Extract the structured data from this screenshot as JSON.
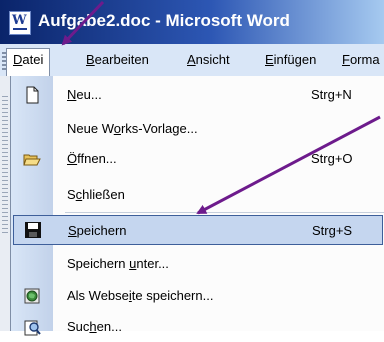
{
  "window": {
    "title": "Aufgabe2.doc - Microsoft Word",
    "app_icon": "word-doc-icon"
  },
  "menubar": {
    "items": [
      {
        "label_pre": "",
        "label_acc": "D",
        "label_post": "atei",
        "open": true
      },
      {
        "label_pre": "",
        "label_acc": "B",
        "label_post": "earbeiten"
      },
      {
        "label_pre": "",
        "label_acc": "A",
        "label_post": "nsicht"
      },
      {
        "label_pre": "",
        "label_acc": "E",
        "label_post": "infügen"
      },
      {
        "label_pre": "",
        "label_acc": "F",
        "label_post": "orma"
      }
    ]
  },
  "file_menu": {
    "items": [
      {
        "pre": "",
        "acc": "N",
        "post": "eu...",
        "shortcut": "Strg+N",
        "icon": "new-document-icon"
      },
      {
        "pre": "Neue W",
        "acc": "o",
        "post": "rks-Vorlage...",
        "shortcut": "",
        "icon": ""
      },
      {
        "pre": "",
        "acc": "Ö",
        "post": "ffnen...",
        "shortcut": "Strg+O",
        "icon": "open-folder-icon"
      },
      {
        "pre": "S",
        "acc": "c",
        "post": "hließen",
        "shortcut": "",
        "icon": ""
      },
      {
        "pre": "",
        "acc": "S",
        "post": "peichern",
        "shortcut": "Strg+S",
        "icon": "save-floppy-icon",
        "highlighted": true
      },
      {
        "pre": "Speichern ",
        "acc": "u",
        "post": "nter...",
        "shortcut": "",
        "icon": ""
      },
      {
        "pre": "Als Webse",
        "acc": "i",
        "post": "te speichern...",
        "shortcut": "",
        "icon": "save-as-web-icon"
      },
      {
        "pre": "Suc",
        "acc": "h",
        "post": "en...",
        "shortcut": "",
        "icon": "search-icon"
      }
    ]
  },
  "annotation_color": "#6d1b8c"
}
